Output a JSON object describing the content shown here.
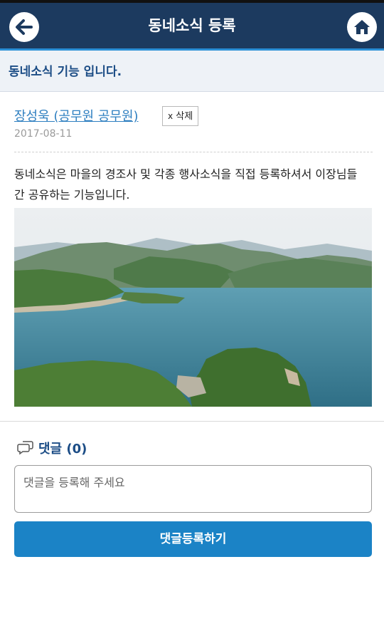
{
  "header": {
    "title": "동네소식 등록",
    "back_icon": "arrow-left-icon",
    "home_icon": "home-icon"
  },
  "notice": {
    "text": "동네소식 기능 입니다."
  },
  "post": {
    "author": "장성욱 (공무원 공무원)",
    "delete_label": "삭제",
    "delete_icon": "x",
    "date": "2017-08-11",
    "content": "동네소식은 마을의 경조사 및 각종 행사소식을 직접 등록하셔서 이장님들간 공유하는 기능입니다.",
    "image_icon": "lake-landscape-photo"
  },
  "comments": {
    "label": "댓글 (0)",
    "icon": "speech-bubble-icon",
    "placeholder": "댓글을 등록해 주세요",
    "value": "",
    "submit_label": "댓글등록하기"
  },
  "colors": {
    "header_bg": "#1c3a5f",
    "accent": "#1b83c6",
    "link": "#2e7fc0",
    "notice_bg": "#eef2f7",
    "notice_text": "#1c4d86"
  }
}
